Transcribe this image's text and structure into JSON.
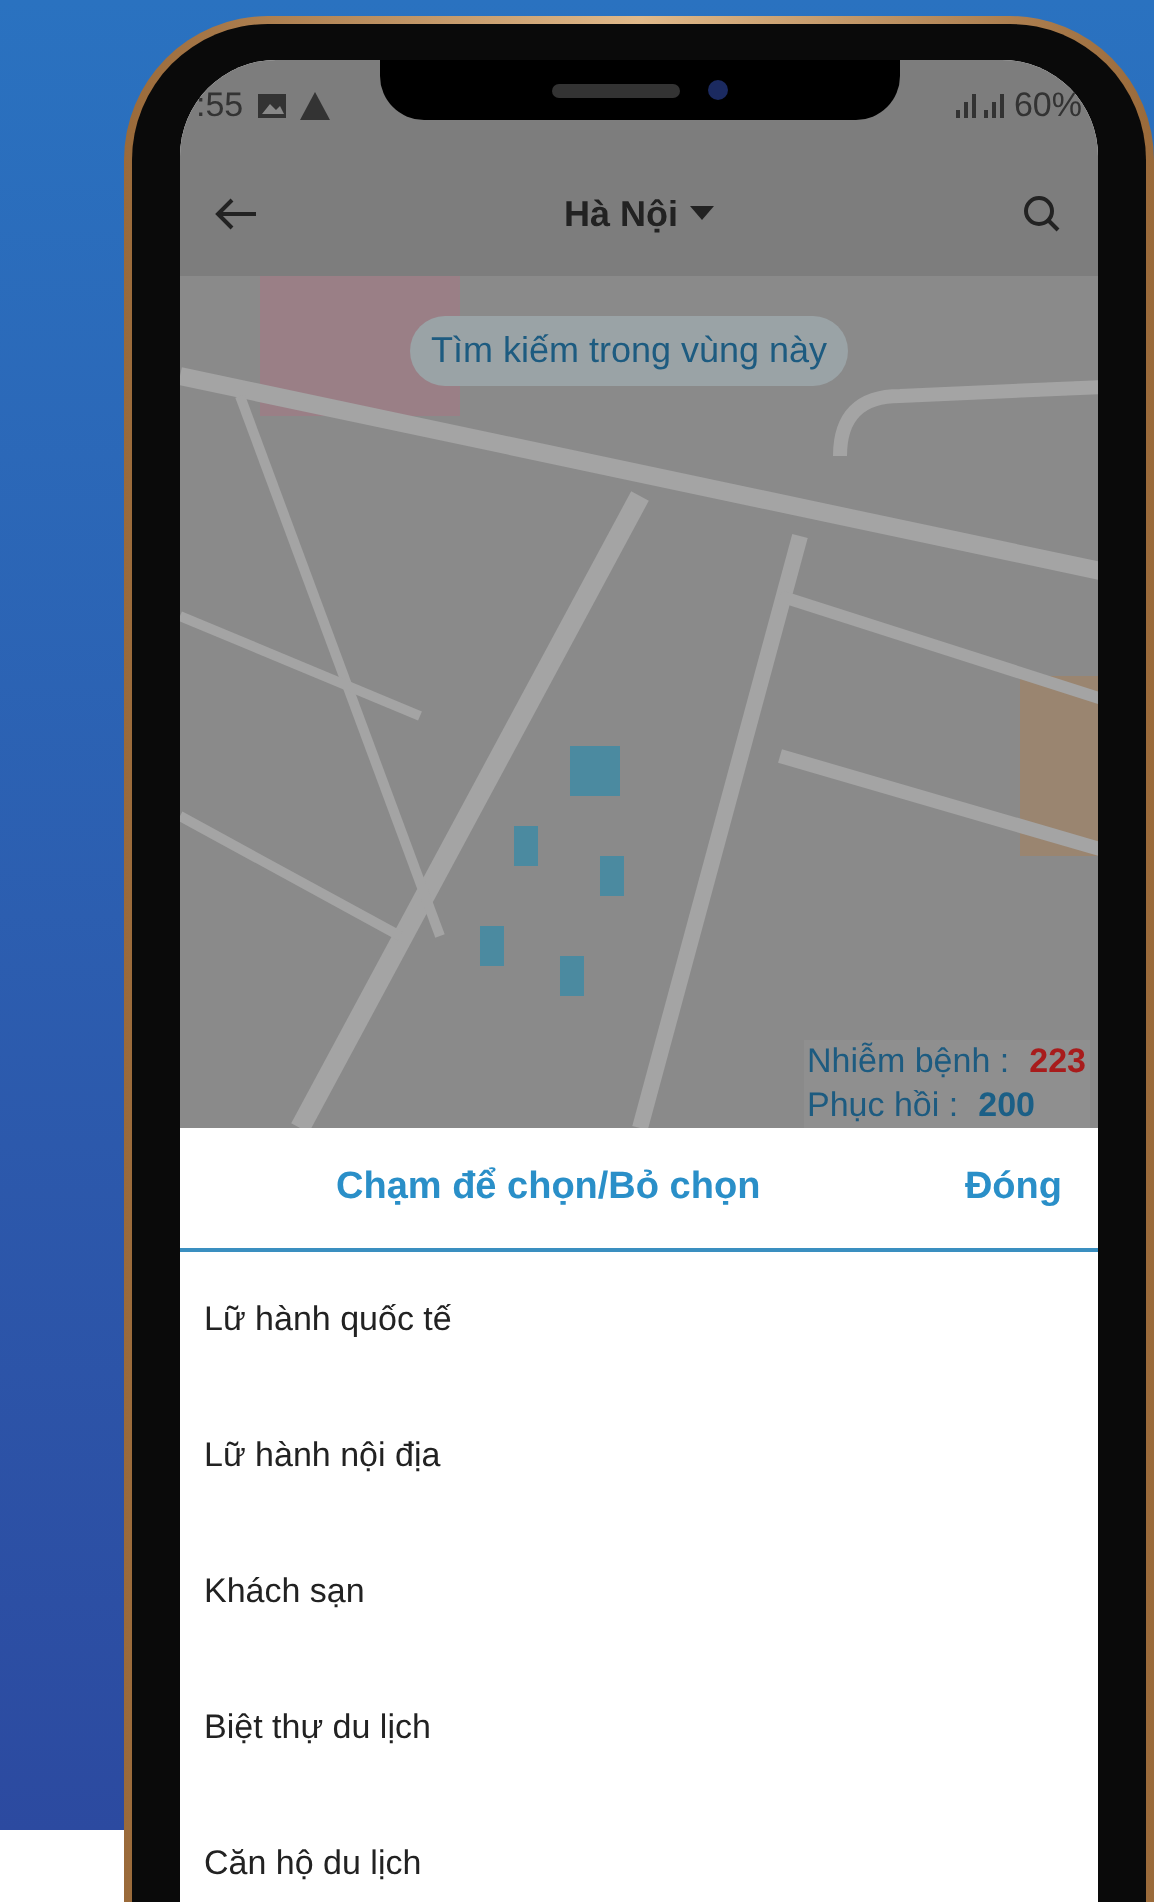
{
  "status_bar": {
    "time": ":55",
    "battery": "60%"
  },
  "app_bar": {
    "title": "Hà Nội"
  },
  "map": {
    "search_area_button": "Tìm kiếm trong vùng này",
    "stats": [
      {
        "label": "Nhiễm bệnh :",
        "value": "223",
        "color": "#a81c1c"
      },
      {
        "label": "Phục hồi :",
        "value": "200",
        "color": "#1b5f86"
      }
    ]
  },
  "sheet": {
    "title": "Chạm để chọn/Bỏ chọn",
    "close": "Đóng",
    "items": [
      {
        "label": "Lữ hành quốc tế"
      },
      {
        "label": "Lữ hành nội địa"
      },
      {
        "label": "Khách sạn"
      },
      {
        "label": "Biệt thự du lịch"
      },
      {
        "label": "Căn hộ du lịch"
      }
    ]
  }
}
